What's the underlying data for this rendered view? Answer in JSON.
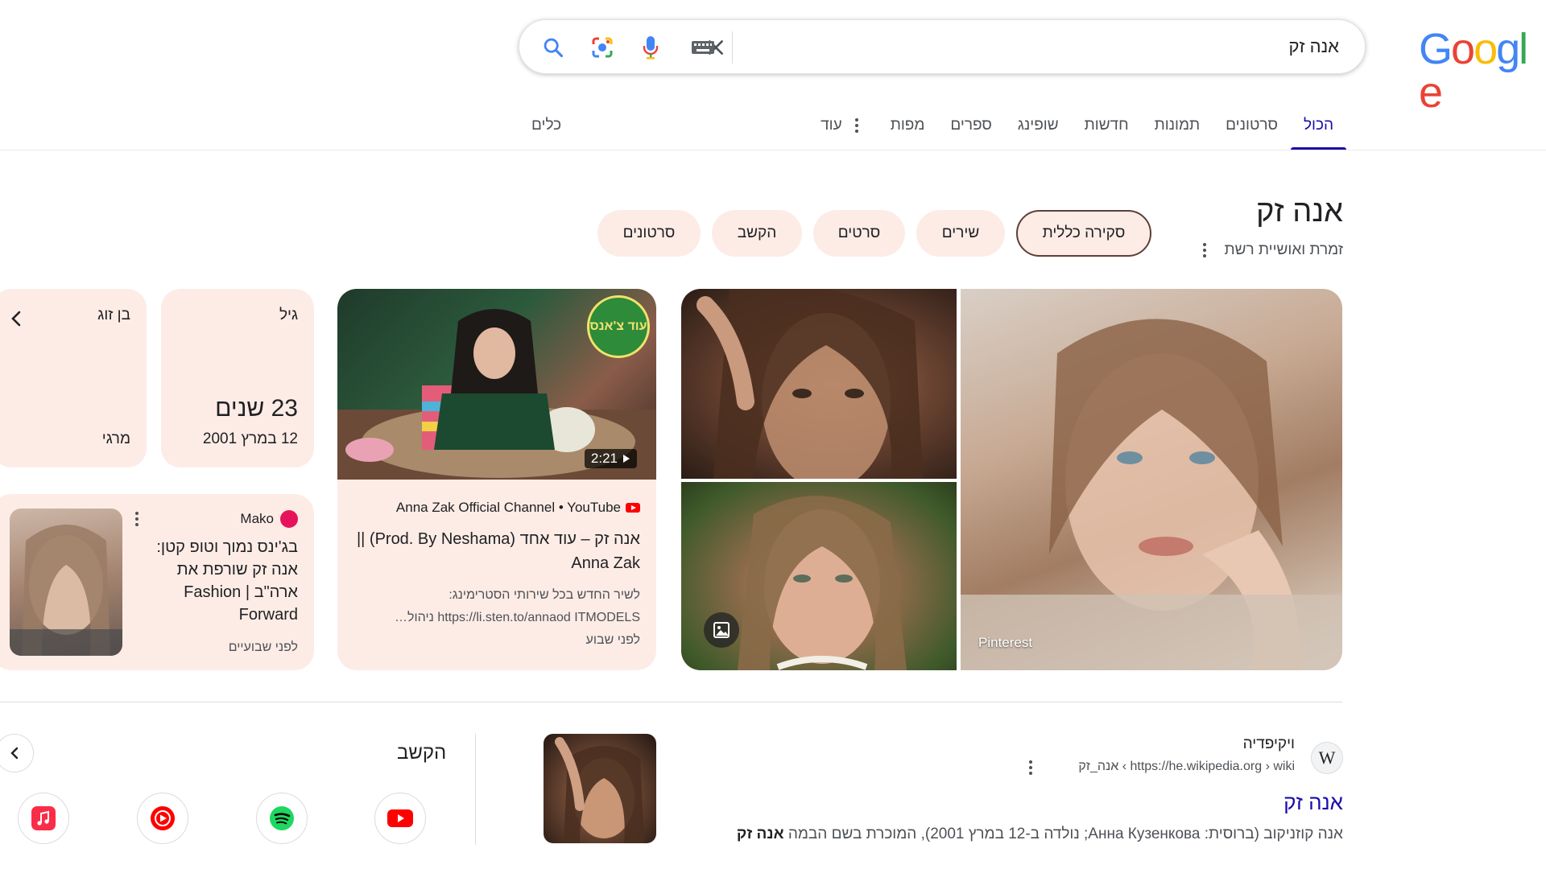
{
  "logo": {
    "letters": [
      "G",
      "o",
      "o",
      "g",
      "l",
      "e"
    ],
    "colors": [
      "#4285F4",
      "#EA4335",
      "#FBBC05",
      "#4285F4",
      "#34A853",
      "#EA4335"
    ]
  },
  "search": {
    "query": "אנה זק"
  },
  "tabs": [
    "הכול",
    "סרטונים",
    "תמונות",
    "חדשות",
    "שופינג",
    "ספרים",
    "מפות",
    "עוד"
  ],
  "tools_label": "כלים",
  "entity": {
    "title": "אנה זק",
    "subtitle": "זמרת ואושיית רשת",
    "chips": [
      "סקירה כללית",
      "שירים",
      "סרטים",
      "הקשב",
      "סרטונים"
    ]
  },
  "images": {
    "main_source": "Pinterest"
  },
  "video": {
    "badge": "עוד צ'אנס",
    "duration": "2:21",
    "source": "Anna Zak Official Channel • YouTube",
    "title": "אנה זק – עוד אחד (Prod. By Neshama) || Anna Zak",
    "desc_line1": "לשיר החדש בכל שירותי הסטרימינג:",
    "desc_line2": "https://li.sten.to/annaod ITMODELS ניהול…",
    "time": "לפני שבוע"
  },
  "facts": {
    "age_label": "גיל",
    "age_value": "23 שנים",
    "age_date": "12 במרץ 2001",
    "spouse_label": "בן זוג",
    "spouse_value": "מרגי"
  },
  "news": {
    "source": "Mako",
    "title": "בג'ינס נמוך וטופ קטן: אנה זק שורפת את ארה\"ב | Fashion Forward",
    "time": "לפני שבועיים"
  },
  "wiki": {
    "site": "ויקיפדיה",
    "url": "https://he.wikipedia.org › wiki › אנה_זק",
    "title": "אנה זק",
    "snippet_prefix": "אנה קוזניקוב (ברוסית: Анна Кузенкова; נולדה ב-12 במרץ 2001), המוכרת בשם הבמה ",
    "snippet_bold": "אנה זק"
  },
  "listen": {
    "title": "הקשב",
    "services": [
      "youtube-icon",
      "spotify-icon",
      "youtube-music-icon",
      "apple-music-icon"
    ]
  },
  "colors": {
    "accent": "#1a0dab",
    "card": "#fdece6",
    "chip_border": "#5c4037"
  }
}
